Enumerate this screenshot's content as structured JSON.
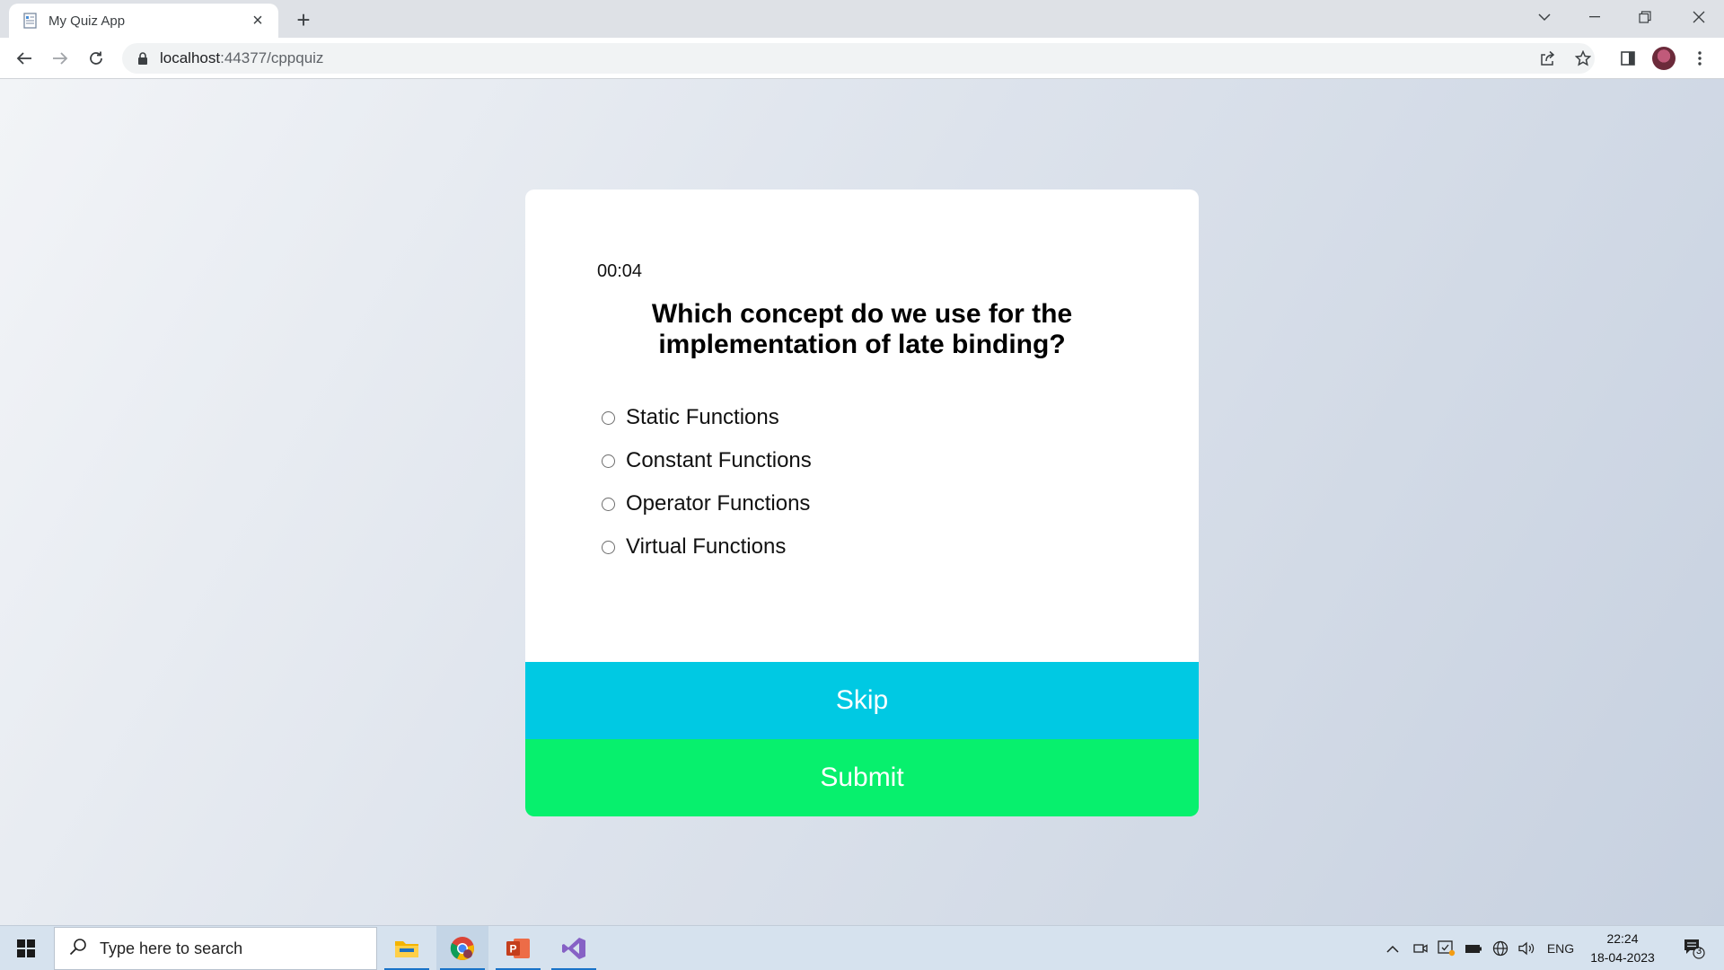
{
  "browser": {
    "tab_title": "My Quiz App",
    "url_host": "localhost",
    "url_rest": ":44377/cppquiz"
  },
  "quiz": {
    "timer": "00:04",
    "question": "Which concept do we use for the implementation of late binding?",
    "options": [
      "Static Functions",
      "Constant Functions",
      "Operator Functions",
      "Virtual Functions"
    ],
    "skip_label": "Skip",
    "submit_label": "Submit",
    "colors": {
      "skip": "#00c9e3",
      "submit": "#07f06d"
    }
  },
  "taskbar": {
    "search_placeholder": "Type here to search",
    "language": "ENG",
    "time": "22:24",
    "date": "18-04-2023",
    "notification_count": "3",
    "apps": [
      "file-explorer-icon",
      "chrome-icon",
      "powerpoint-icon",
      "visual-studio-icon"
    ]
  }
}
